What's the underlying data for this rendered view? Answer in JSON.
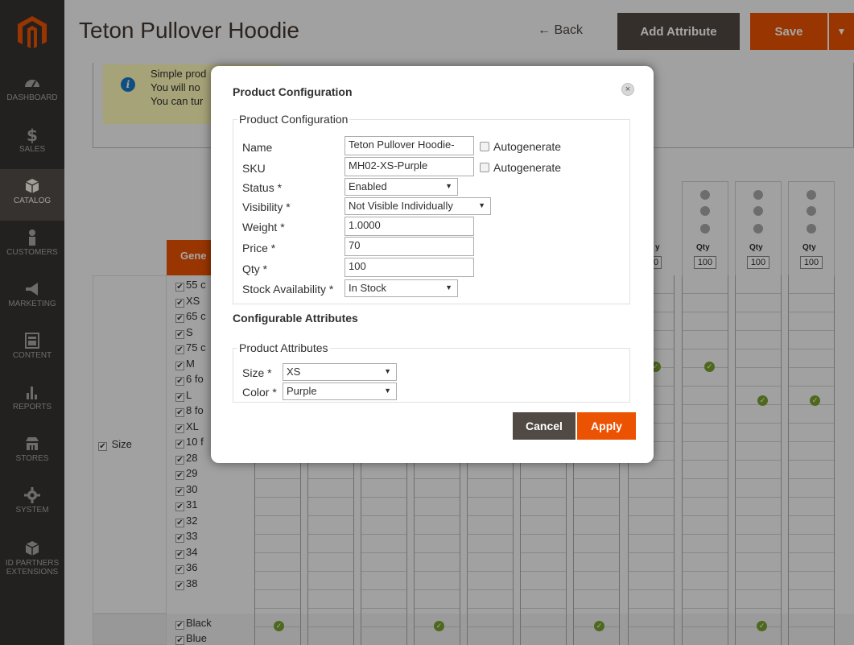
{
  "sidebar": {
    "items": [
      {
        "label": "DASHBOARD",
        "icon": "dashboard-icon"
      },
      {
        "label": "SALES",
        "icon": "dollar-icon"
      },
      {
        "label": "CATALOG",
        "icon": "cube-icon",
        "active": true
      },
      {
        "label": "CUSTOMERS",
        "icon": "person-icon"
      },
      {
        "label": "MARKETING",
        "icon": "megaphone-icon"
      },
      {
        "label": "CONTENT",
        "icon": "content-icon"
      },
      {
        "label": "REPORTS",
        "icon": "bar-chart-icon"
      },
      {
        "label": "STORES",
        "icon": "store-icon"
      },
      {
        "label": "SYSTEM",
        "icon": "gear-icon"
      },
      {
        "label": "ID PARTNERS & EXTENSIONS",
        "label_line1": "ID PARTNERS",
        "label_line2": "EXTENSIONS",
        "icon": "box-icon"
      }
    ]
  },
  "header": {
    "title": "Teton Pullover Hoodie",
    "back_label": "← Back",
    "add_attribute_label": "Add Attribute",
    "save_label": "Save",
    "save_menu_glyph": "▼"
  },
  "notice": {
    "line1": "Simple prod",
    "line2": "You will no",
    "line3": "You can tur"
  },
  "matrix": {
    "general_label": "Gene",
    "size_label": "Size",
    "size_options": [
      "55 c",
      "XS",
      "65 c",
      "S",
      "75 c",
      "M",
      "6 fo",
      "L",
      "8 fo",
      "XL",
      "10 f",
      "28",
      "29",
      "30",
      "31",
      "32",
      "33",
      "34",
      "36",
      "38"
    ],
    "color_options": [
      "Black",
      "Blue"
    ],
    "qty_label": "Qty",
    "qty_value": "100",
    "qty_partial": "0",
    "qty_partial_label": "y"
  },
  "modal": {
    "title": "Product Configuration",
    "close_glyph": "×",
    "config_legend": "Product Configuration",
    "fields": {
      "name": {
        "label": "Name",
        "value": "Teton Pullover Hoodie-"
      },
      "sku": {
        "label": "SKU",
        "value": "MH02-XS-Purple"
      },
      "status": {
        "label": "Status *",
        "value": "Enabled"
      },
      "visibility": {
        "label": "Visibility *",
        "value": "Not Visible Individually"
      },
      "weight": {
        "label": "Weight *",
        "value": "1.0000"
      },
      "price": {
        "label": "Price *",
        "value": "70"
      },
      "qty": {
        "label": "Qty *",
        "value": "100"
      },
      "stock": {
        "label": "Stock Availability *",
        "value": "In Stock"
      }
    },
    "autogenerate_label": "Autogenerate",
    "configurable_heading": "Configurable Attributes",
    "attrs_legend": "Product Attributes",
    "attrs": {
      "size": {
        "label": "Size *",
        "value": "XS"
      },
      "color": {
        "label": "Color *",
        "value": "Purple"
      }
    },
    "cancel_label": "Cancel",
    "apply_label": "Apply"
  },
  "colors": {
    "accent": "#eb5202",
    "dark_button": "#514943",
    "sidebar": "#373330",
    "success": "#79a22e"
  }
}
